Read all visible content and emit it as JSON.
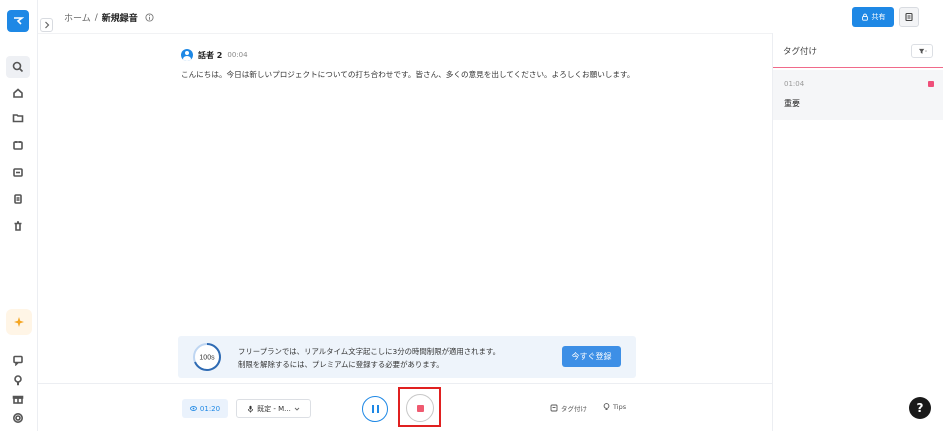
{
  "breadcrumb": {
    "home": "ホーム",
    "separator": "/",
    "current": "新規録音",
    "info_icon": "info-icon"
  },
  "header": {
    "share_label": "共有",
    "share_icon": "lock-icon",
    "doc_icon": "document-icon"
  },
  "sidebar": {
    "logo_icon": "logo-icon",
    "items": [
      {
        "icon": "search-icon"
      },
      {
        "icon": "home-icon"
      },
      {
        "icon": "folder-icon"
      },
      {
        "icon": "calendar-icon"
      },
      {
        "icon": "calendar-edit-icon"
      },
      {
        "icon": "file-icon"
      },
      {
        "icon": "trash-icon"
      }
    ],
    "ai_icon": "sparkle-icon",
    "bottom_items": [
      {
        "icon": "chat-icon"
      },
      {
        "icon": "lightbulb-icon"
      },
      {
        "icon": "gift-icon"
      },
      {
        "icon": "settings-icon"
      }
    ]
  },
  "transcript": {
    "speaker": "話者 2",
    "time": "00:04",
    "text": "こんにちは。今日は新しいプロジェクトについての打ち合わせです。皆さん、多くの意見を出してください。よろしくお願いします。"
  },
  "banner": {
    "timer_label": "100s",
    "line1": "フリープランでは、リアルタイム文字起こしに3分の時間制限が適用されます。",
    "line2": "制限を解除するには、プレミアムに登録する必要があります。",
    "cta": "今すぐ登録"
  },
  "controls": {
    "elapsed": "01:20",
    "mic_label": "既定 - M...",
    "tag_link": "タグ付け",
    "tips_link": "Tips"
  },
  "tags_panel": {
    "title": "タグ付け",
    "filter_icon": "filter-icon",
    "items": [
      {
        "time": "01:04",
        "name": "重要",
        "color": "#ef4f7a"
      }
    ]
  },
  "help_label": "?",
  "colors": {
    "accent": "#1e88e5",
    "stop": "#ef5a70",
    "highlight": "#e02020"
  }
}
